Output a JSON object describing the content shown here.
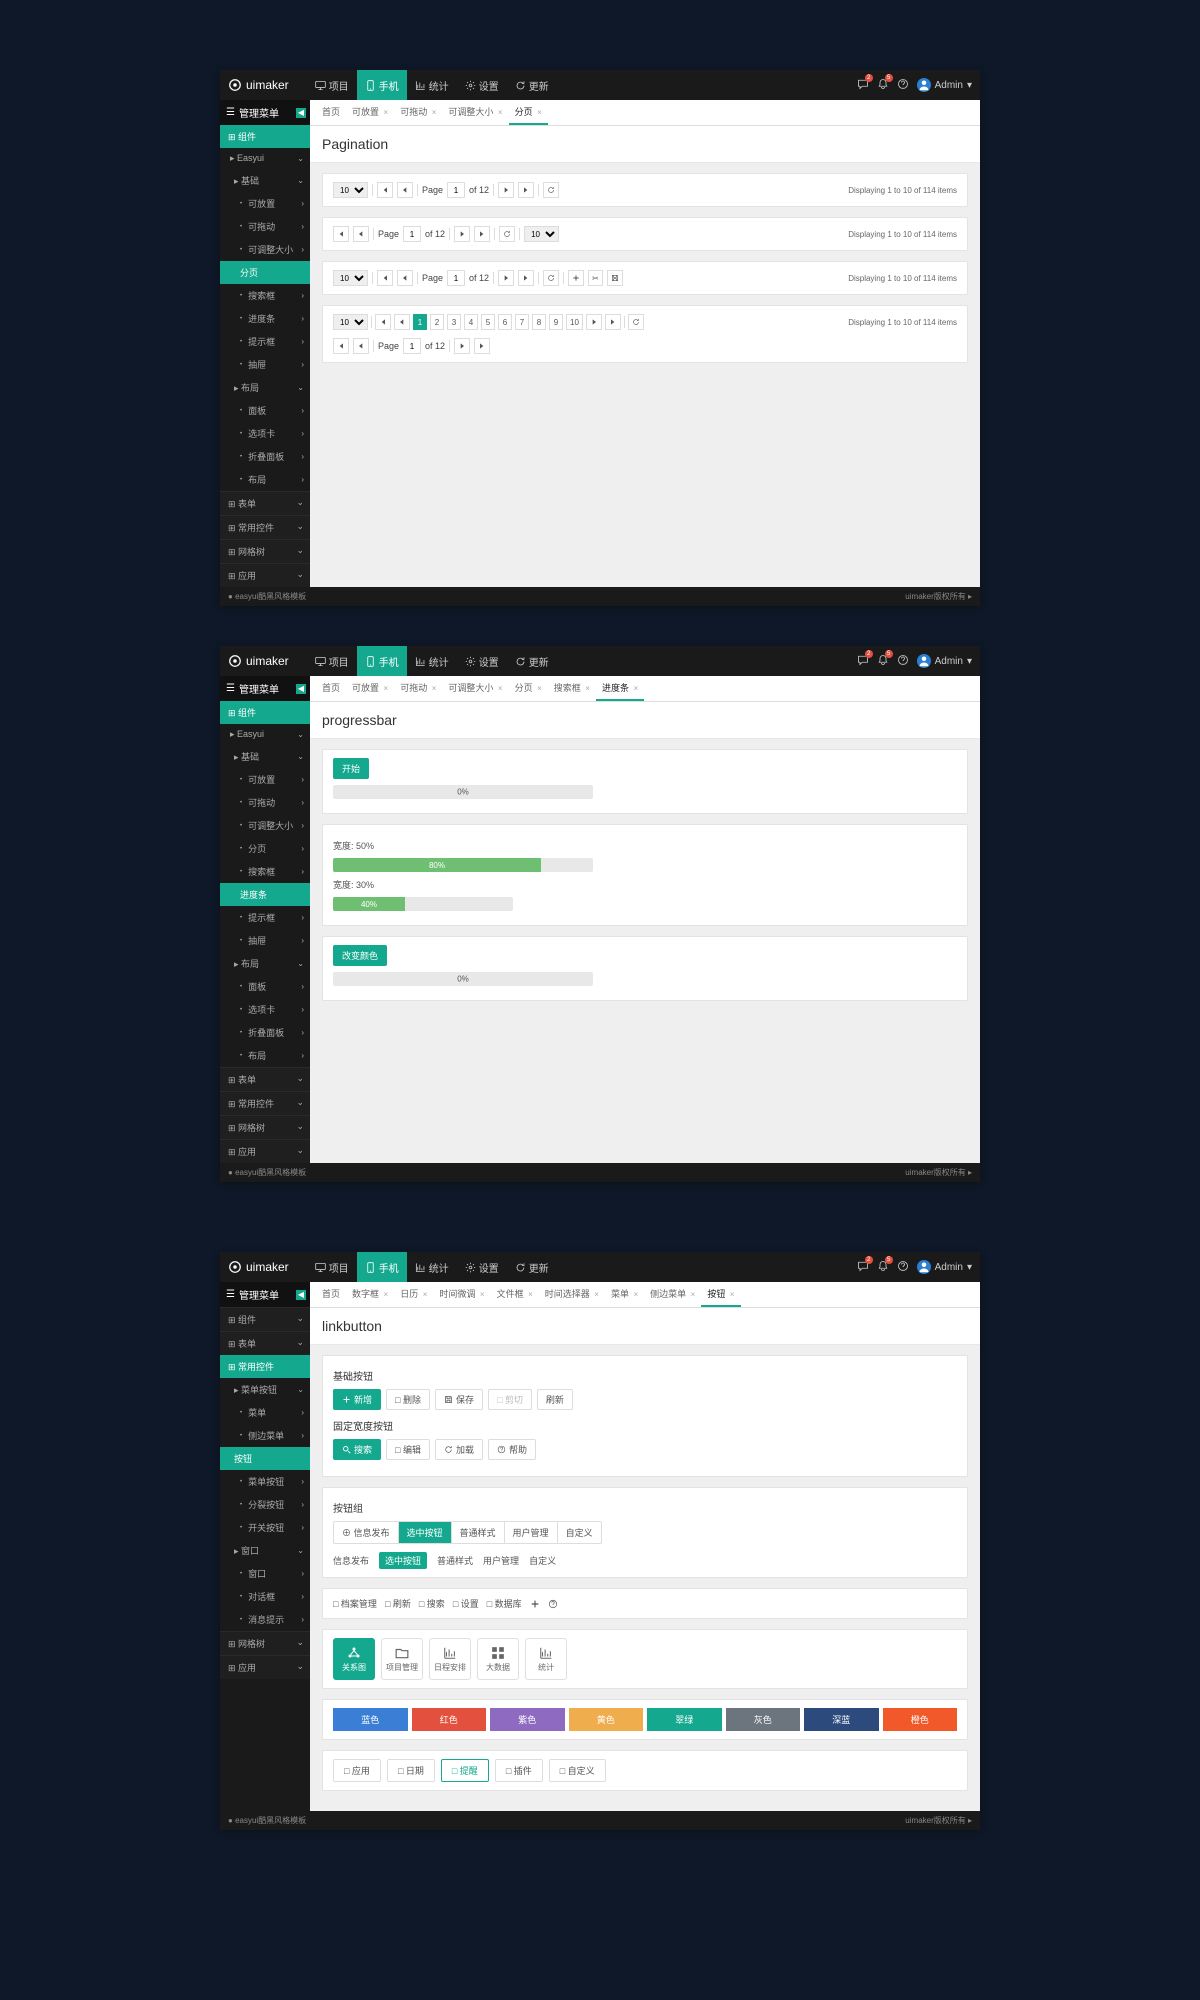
{
  "brand": "uimaker",
  "topnav": [
    {
      "icon": "desktop",
      "label": "项目"
    },
    {
      "icon": "mobile",
      "label": "手机"
    },
    {
      "icon": "chart",
      "label": "统计"
    },
    {
      "icon": "gear",
      "label": "设置"
    },
    {
      "icon": "refresh",
      "label": "更新"
    }
  ],
  "user": {
    "name": "Admin"
  },
  "sidebar": {
    "title": "管理菜单",
    "pagination": {
      "header": "组件",
      "items": [
        {
          "label": "Easyui",
          "lvl": 0,
          "type": "folder"
        },
        {
          "label": "基础",
          "lvl": 1,
          "type": "folder"
        },
        {
          "label": "可放置",
          "lvl": 2,
          "type": "dot"
        },
        {
          "label": "可拖动",
          "lvl": 2,
          "type": "dot"
        },
        {
          "label": "可调整大小",
          "lvl": 2,
          "type": "dot"
        },
        {
          "label": "分页",
          "lvl": 2,
          "type": "active"
        },
        {
          "label": "搜索框",
          "lvl": 2,
          "type": "dot"
        },
        {
          "label": "进度条",
          "lvl": 2,
          "type": "dot"
        },
        {
          "label": "提示框",
          "lvl": 2,
          "type": "dot"
        },
        {
          "label": "抽屉",
          "lvl": 2,
          "type": "dot"
        },
        {
          "label": "布局",
          "lvl": 1,
          "type": "folder"
        },
        {
          "label": "面板",
          "lvl": 2,
          "type": "dot"
        },
        {
          "label": "选项卡",
          "lvl": 2,
          "type": "dot"
        },
        {
          "label": "折叠面板",
          "lvl": 2,
          "type": "dot"
        },
        {
          "label": "布局",
          "lvl": 2,
          "type": "dot"
        }
      ],
      "secs": [
        "表单",
        "常用控件",
        "网格树",
        "应用"
      ]
    },
    "progressbar": {
      "header": "组件",
      "items": [
        {
          "label": "Easyui",
          "lvl": 0,
          "type": "folder"
        },
        {
          "label": "基础",
          "lvl": 1,
          "type": "folder"
        },
        {
          "label": "可放置",
          "lvl": 2,
          "type": "dot"
        },
        {
          "label": "可拖动",
          "lvl": 2,
          "type": "dot"
        },
        {
          "label": "可调整大小",
          "lvl": 2,
          "type": "dot"
        },
        {
          "label": "分页",
          "lvl": 2,
          "type": "dot"
        },
        {
          "label": "搜索框",
          "lvl": 2,
          "type": "dot"
        },
        {
          "label": "进度条",
          "lvl": 2,
          "type": "active"
        },
        {
          "label": "提示框",
          "lvl": 2,
          "type": "dot"
        },
        {
          "label": "抽屉",
          "lvl": 2,
          "type": "dot"
        },
        {
          "label": "布局",
          "lvl": 1,
          "type": "folder"
        },
        {
          "label": "面板",
          "lvl": 2,
          "type": "dot"
        },
        {
          "label": "选项卡",
          "lvl": 2,
          "type": "dot"
        },
        {
          "label": "折叠面板",
          "lvl": 2,
          "type": "dot"
        },
        {
          "label": "布局",
          "lvl": 2,
          "type": "dot"
        }
      ],
      "secs": [
        "表单",
        "常用控件",
        "网格树",
        "应用"
      ]
    },
    "linkbutton": {
      "header": "常用控件",
      "pre": [
        {
          "label": "组件"
        },
        {
          "label": "表单"
        }
      ],
      "items": [
        {
          "label": "菜单按钮",
          "lvl": 1,
          "type": "folder"
        },
        {
          "label": "菜单",
          "lvl": 2,
          "type": "dot"
        },
        {
          "label": "侧边菜单",
          "lvl": 2,
          "type": "dot"
        },
        {
          "label": "按钮",
          "lvl": 1,
          "type": "active"
        },
        {
          "label": "菜单按钮",
          "lvl": 2,
          "type": "dot"
        },
        {
          "label": "分裂按钮",
          "lvl": 2,
          "type": "dot"
        },
        {
          "label": "开关按钮",
          "lvl": 2,
          "type": "dot"
        },
        {
          "label": "窗口",
          "lvl": 1,
          "type": "folder"
        },
        {
          "label": "窗口",
          "lvl": 2,
          "type": "dot"
        },
        {
          "label": "对话框",
          "lvl": 2,
          "type": "dot"
        },
        {
          "label": "消息提示",
          "lvl": 2,
          "type": "dot"
        }
      ],
      "secs": [
        "网格树",
        "应用"
      ]
    }
  },
  "tabs": {
    "pagination": [
      {
        "label": "首页"
      },
      {
        "label": "可放置",
        "x": true
      },
      {
        "label": "可拖动",
        "x": true
      },
      {
        "label": "可调整大小",
        "x": true
      },
      {
        "label": "分页",
        "x": true,
        "active": true
      }
    ],
    "progressbar": [
      {
        "label": "首页"
      },
      {
        "label": "可放置",
        "x": true
      },
      {
        "label": "可拖动",
        "x": true
      },
      {
        "label": "可调整大小",
        "x": true
      },
      {
        "label": "分页",
        "x": true
      },
      {
        "label": "搜索框",
        "x": true
      },
      {
        "label": "进度条",
        "x": true,
        "active": true
      }
    ],
    "linkbutton": [
      {
        "label": "首页"
      },
      {
        "label": "数字框",
        "x": true
      },
      {
        "label": "日历",
        "x": true
      },
      {
        "label": "时间微调",
        "x": true
      },
      {
        "label": "文件框",
        "x": true
      },
      {
        "label": "时间选择器",
        "x": true
      },
      {
        "label": "菜单",
        "x": true
      },
      {
        "label": "侧边菜单",
        "x": true
      },
      {
        "label": "按钮",
        "x": true,
        "active": true
      }
    ]
  },
  "pages": {
    "pagination": {
      "title": "Pagination",
      "pagesize": "10",
      "pagelabel": "Page",
      "pageval": "1",
      "oflabel": "of 12",
      "info": "Displaying 1 to 10 of 114 items",
      "nums": [
        "1",
        "2",
        "3",
        "4",
        "5",
        "6",
        "7",
        "8",
        "9",
        "10"
      ]
    },
    "progressbar": {
      "title": "progressbar",
      "start": "开始",
      "p0": "0%",
      "w50": "宽度: 50%",
      "p80": "80%",
      "w30": "宽度: 30%",
      "p40": "40%",
      "changecolor": "改变颜色",
      "p0b": "0%"
    },
    "linkbutton": {
      "title": "linkbutton",
      "basic": "基础按钮",
      "btns1": [
        {
          "t": "新增",
          "style": "teal",
          "icon": "plus"
        },
        {
          "t": "删除",
          "style": "out",
          "icon": "trash"
        },
        {
          "t": "保存",
          "style": "out",
          "icon": "save"
        },
        {
          "t": "剪切",
          "style": "out disabled",
          "icon": "cut"
        },
        {
          "t": "刷新",
          "style": "plain"
        }
      ],
      "fixed": "固定宽度按钮",
      "btns2": [
        {
          "t": "搜索",
          "style": "teal",
          "icon": "search"
        },
        {
          "t": "编辑",
          "style": "out",
          "icon": "edit"
        },
        {
          "t": "加载",
          "style": "out",
          "icon": "reload"
        },
        {
          "t": "帮助",
          "style": "out",
          "icon": "help"
        }
      ],
      "group": "按钮组",
      "grp": [
        "信息发布",
        "选中按钮",
        "普通样式",
        "用户管理",
        "自定义"
      ],
      "links": [
        "信息发布",
        "选中按钮",
        "普通样式",
        "用户管理",
        "自定义"
      ],
      "toolbar": [
        {
          "t": "档案管理",
          "i": "archive"
        },
        {
          "t": "刷新",
          "i": "refresh"
        },
        {
          "t": "搜索",
          "i": "search"
        },
        {
          "t": "设置",
          "i": ""
        },
        {
          "t": "数据库",
          "i": "db"
        }
      ],
      "tbicons": [
        "plus",
        "close",
        "user"
      ],
      "big": [
        {
          "t": "关系图",
          "on": true
        },
        {
          "t": "项目管理"
        },
        {
          "t": "日程安排"
        },
        {
          "t": "大数据"
        },
        {
          "t": "统计"
        }
      ],
      "colors": [
        {
          "t": "蓝色",
          "c": "#3a7fd5"
        },
        {
          "t": "红色",
          "c": "#e3503e"
        },
        {
          "t": "紫色",
          "c": "#8e6bc1"
        },
        {
          "t": "黄色",
          "c": "#f0ad4e"
        },
        {
          "t": "翠绿",
          "c": "#14a88e"
        },
        {
          "t": "灰色",
          "c": "#6c757d"
        },
        {
          "t": "深蓝",
          "c": "#2c4a7c"
        },
        {
          "t": "橙色",
          "c": "#f1592a"
        }
      ],
      "outline": [
        {
          "t": "应用",
          "i": "app"
        },
        {
          "t": "日期",
          "i": "cal"
        },
        {
          "t": "提醒",
          "i": "bell",
          "on": true
        },
        {
          "t": "插件",
          "i": "plug"
        },
        {
          "t": "自定义",
          "i": ""
        }
      ]
    }
  },
  "footer": {
    "left": "easyui酷黑风格模板",
    "right": "uimaker版权所有 ▸"
  }
}
